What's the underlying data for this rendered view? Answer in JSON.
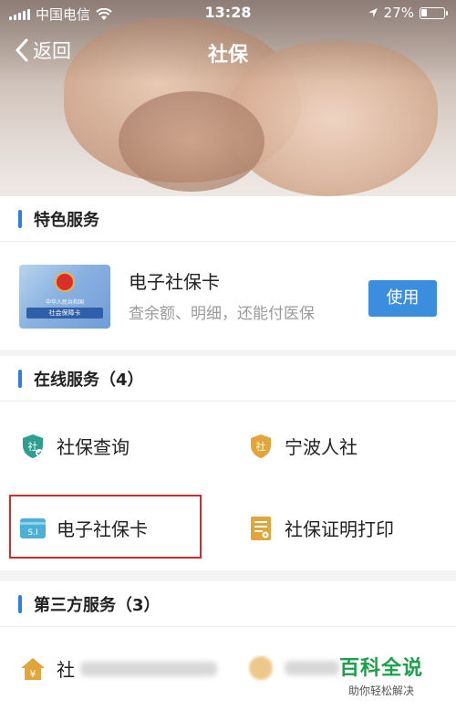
{
  "status": {
    "carrier": "中国电信",
    "time": "13:28",
    "battery": "27%",
    "battery_level": 0.27
  },
  "nav": {
    "back_label": "返回",
    "title": "社保"
  },
  "featured": {
    "heading": "特色服务",
    "card": {
      "title": "电子社保卡",
      "desc": "查余额、明细，还能付医保",
      "button": "使用",
      "card_line1": "中华人民共和国",
      "card_line2": "社会保障卡"
    }
  },
  "online": {
    "heading": "在线服务（4）",
    "items": [
      {
        "label": "社保查询",
        "icon": "shield-icon"
      },
      {
        "label": "宁波人社",
        "icon": "shield-icon"
      },
      {
        "label": "电子社保卡",
        "icon": "card-icon"
      },
      {
        "label": "社保证明打印",
        "icon": "document-icon"
      }
    ]
  },
  "third": {
    "heading": "第三方服务（3）",
    "items": [
      {
        "label": "社"
      }
    ]
  },
  "watermark": {
    "title": "百科全说",
    "subtitle": "助你轻松解决"
  },
  "colors": {
    "accent": "#2e7fde",
    "button": "#3b8ede",
    "highlight": "#d12b2b",
    "icon_green": "#2e9e8e",
    "icon_gold": "#e2a53a",
    "watermark": "#19a24a"
  }
}
